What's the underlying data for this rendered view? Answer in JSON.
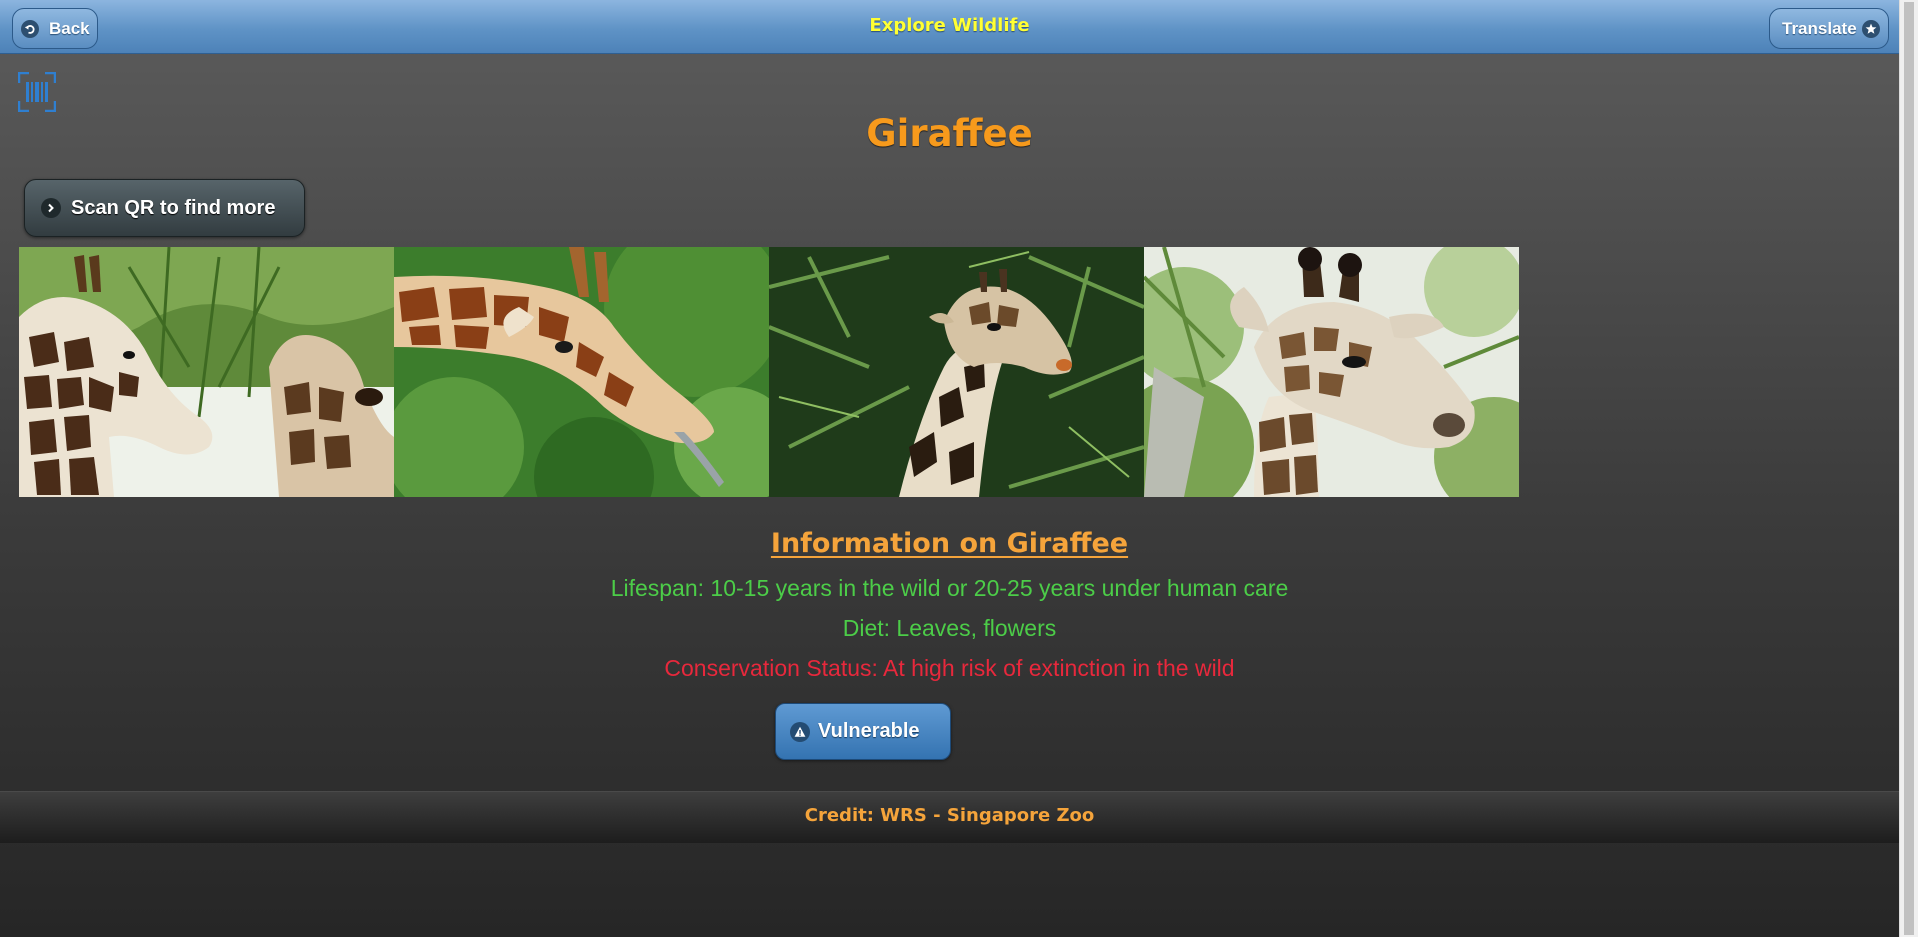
{
  "header": {
    "title": "Explore Wildlife",
    "back_label": "Back",
    "translate_label": "Translate",
    "back_icon": "back-arrow-icon",
    "translate_icon": "star-icon"
  },
  "scanner": {
    "icon": "barcode-icon"
  },
  "animal": {
    "name": "Giraffee"
  },
  "scan_button": {
    "label": "Scan QR to find more",
    "icon": "chevron-right-icon"
  },
  "gallery": {
    "photos": [
      {
        "subject": "giraffes-eating-leaves"
      },
      {
        "subject": "giraffe-tongue"
      },
      {
        "subject": "giraffe-in-palms"
      },
      {
        "subject": "giraffe-portrait"
      }
    ]
  },
  "info": {
    "heading": "Information on Giraffee",
    "lifespan": "Lifespan: 10-15 years in the wild or 20-25 years under human care",
    "diet": "Diet: Leaves, flowers",
    "conservation": "Conservation Status: At high risk of extinction in the wild"
  },
  "status_button": {
    "label": "Vulnerable",
    "icon": "warning-icon"
  },
  "footer": {
    "credit": "Credit: WRS - Singapore Zoo"
  },
  "colors": {
    "header_title": "#ffff33",
    "animal_title": "#f79a1c",
    "info_green": "#4ccd48",
    "info_red": "#e8283c",
    "accent_orange": "#f5a43b",
    "header_blue": "#5f93c6",
    "status_blue": "#3473b1"
  }
}
